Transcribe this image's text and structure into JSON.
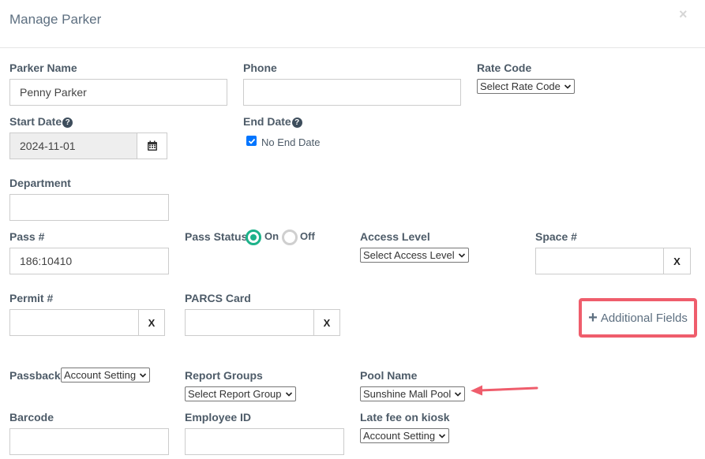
{
  "header": {
    "title": "Manage Parker",
    "close_label": "×"
  },
  "fields": {
    "parker_name": {
      "label": "Parker Name",
      "value": "Penny Parker"
    },
    "phone": {
      "label": "Phone",
      "value": ""
    },
    "rate_code": {
      "label": "Rate Code",
      "selected": "Select Rate Code"
    },
    "start_date": {
      "label": "Start Date",
      "value": "2024-11-01"
    },
    "end_date": {
      "label": "End Date",
      "no_end_label": "No End Date"
    },
    "department": {
      "label": "Department",
      "value": ""
    },
    "pass_num": {
      "label": "Pass #",
      "value": "186:10410"
    },
    "pass_status": {
      "label": "Pass Status",
      "on_label": "On",
      "off_label": "Off",
      "selected": "On"
    },
    "access_level": {
      "label": "Access Level",
      "selected": "Select Access Level"
    },
    "space_num": {
      "label": "Space #",
      "value": "",
      "clear_label": "X"
    },
    "permit_num": {
      "label": "Permit #",
      "value": "",
      "clear_label": "X"
    },
    "parcs_card": {
      "label": "PARCS Card",
      "value": "",
      "clear_label": "X"
    },
    "passback": {
      "label": "Passback",
      "selected": "Account Setting"
    },
    "report_groups": {
      "label": "Report Groups",
      "selected": "Select Report Group"
    },
    "pool_name": {
      "label": "Pool Name",
      "selected": "Sunshine Mall Pool"
    },
    "barcode": {
      "label": "Barcode",
      "value": ""
    },
    "employee_id": {
      "label": "Employee ID",
      "value": ""
    },
    "late_fee": {
      "label": "Late fee on kiosk",
      "selected": "Account Setting"
    }
  },
  "additional_fields": {
    "label": "Additional Fields"
  },
  "annotation": {
    "highlight_color": "#ef5d6c",
    "arrow_color": "#ef5d6c"
  },
  "icons": {
    "help": "question-circle-icon",
    "calendar": "calendar-icon",
    "plus": "plus-icon"
  }
}
